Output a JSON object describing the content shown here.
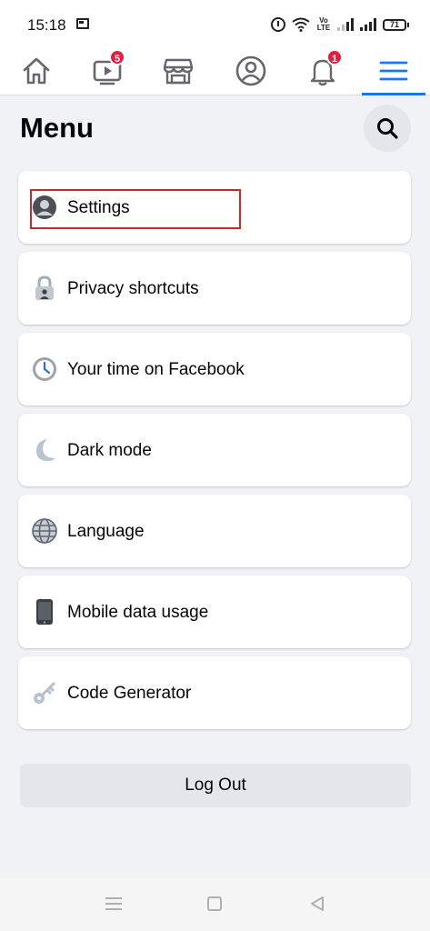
{
  "status_bar": {
    "time": "15:18",
    "volte": "Vo LTE",
    "battery": "71"
  },
  "top_nav": {
    "tabs": [
      {
        "name": "home",
        "icon": "home-icon"
      },
      {
        "name": "watch",
        "icon": "video-icon",
        "badge": "5"
      },
      {
        "name": "marketplace",
        "icon": "marketplace-icon"
      },
      {
        "name": "profile",
        "icon": "profile-icon"
      },
      {
        "name": "notifications",
        "icon": "bell-icon",
        "badge": "1"
      },
      {
        "name": "menu",
        "icon": "hamburger-icon",
        "active": true
      }
    ]
  },
  "header": {
    "title": "Menu",
    "search_icon": "search-icon"
  },
  "menu": {
    "items": [
      {
        "label": "Settings",
        "icon": "settings-avatar-icon",
        "highlighted": true
      },
      {
        "label": "Privacy shortcuts",
        "icon": "lock-icon"
      },
      {
        "label": "Your time on Facebook",
        "icon": "clock-icon"
      },
      {
        "label": "Dark mode",
        "icon": "moon-icon"
      },
      {
        "label": "Language",
        "icon": "globe-icon"
      },
      {
        "label": "Mobile data usage",
        "icon": "phone-icon"
      },
      {
        "label": "Code Generator",
        "icon": "key-icon"
      }
    ]
  },
  "logout": {
    "label": "Log Out"
  },
  "colors": {
    "accent": "#1877f2",
    "badge": "#e41e3f",
    "highlight": "#cc2a2a",
    "background": "#f0f2f5"
  }
}
